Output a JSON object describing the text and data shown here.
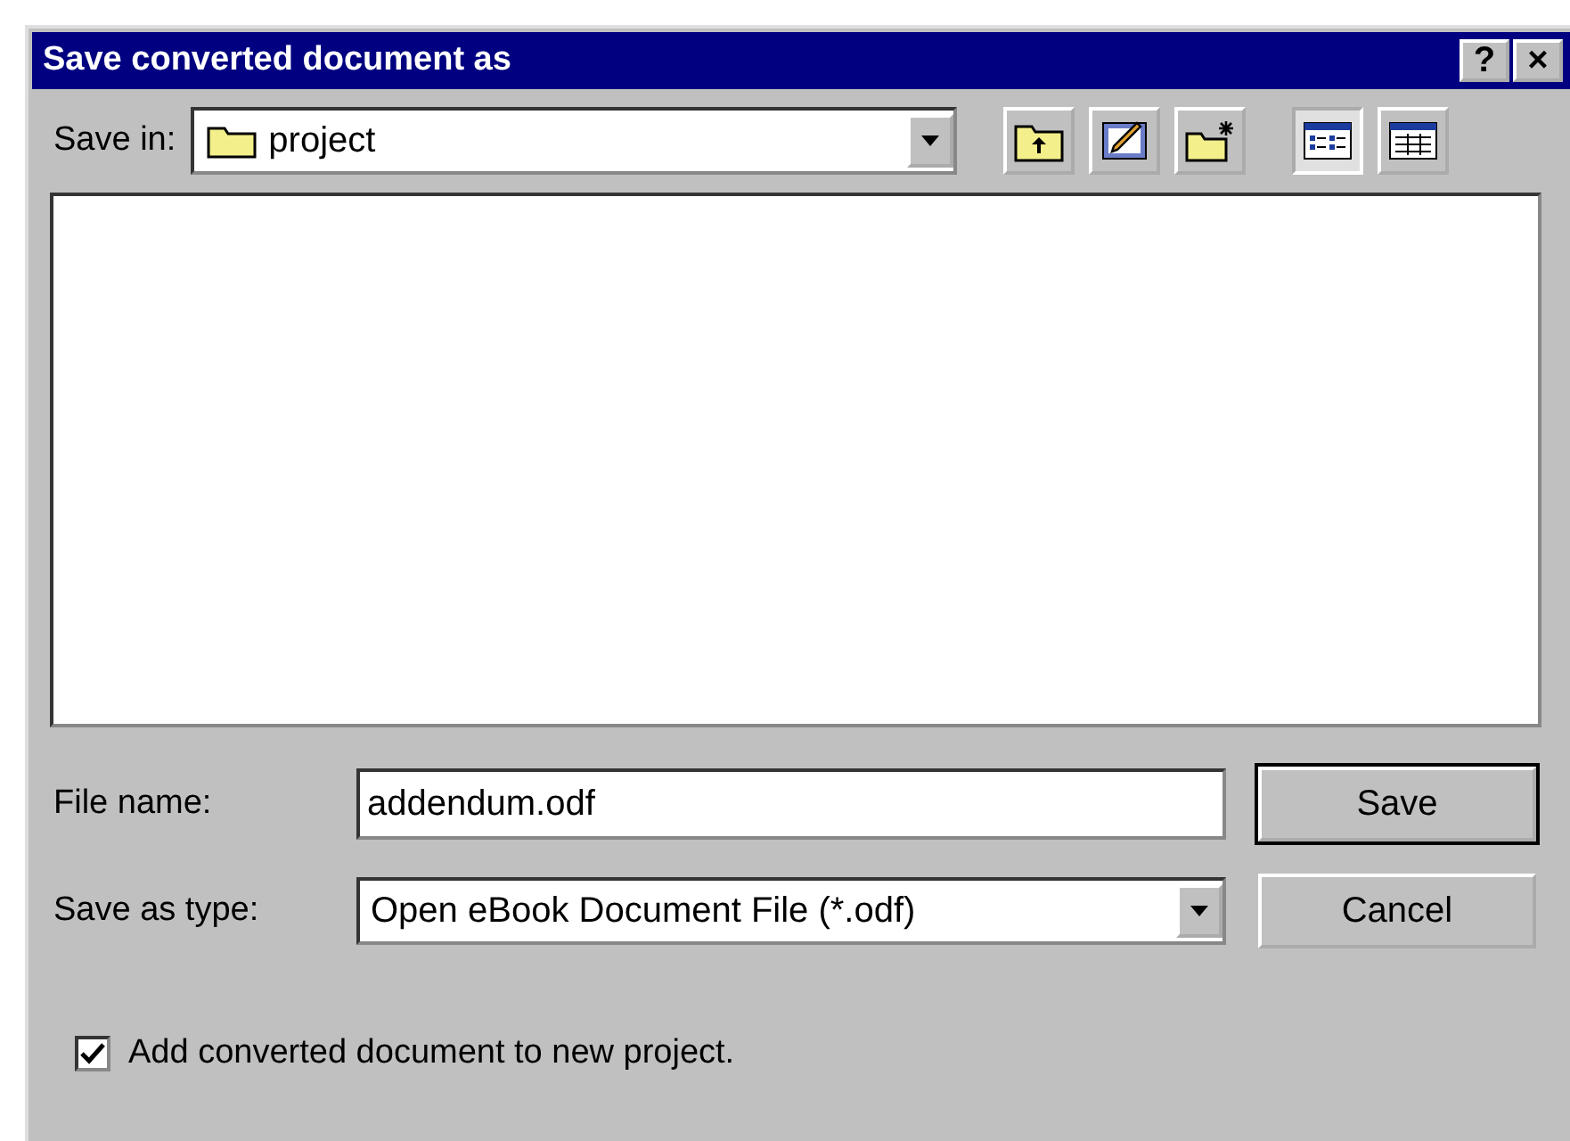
{
  "window": {
    "title": "Save converted document as",
    "help_button": "?",
    "close_button": "×"
  },
  "save_in": {
    "label": "Save in:",
    "value": "project"
  },
  "toolbar": [
    {
      "kind": "up",
      "selected": false
    },
    {
      "kind": "desktop",
      "selected": false
    },
    {
      "kind": "newfolder",
      "selected": false
    },
    {
      "kind": "list",
      "selected": true
    },
    {
      "kind": "details",
      "selected": false
    }
  ],
  "file_name": {
    "label": "File name:",
    "value": "addendum.odf"
  },
  "save_as_type": {
    "label": "Save as type:",
    "value": "Open eBook Document File (*.odf)"
  },
  "buttons": [
    {
      "label": "Save",
      "default": true
    },
    {
      "label": "Cancel",
      "default": false
    }
  ],
  "option": {
    "label": "Add converted document to new project.",
    "checked": true
  }
}
